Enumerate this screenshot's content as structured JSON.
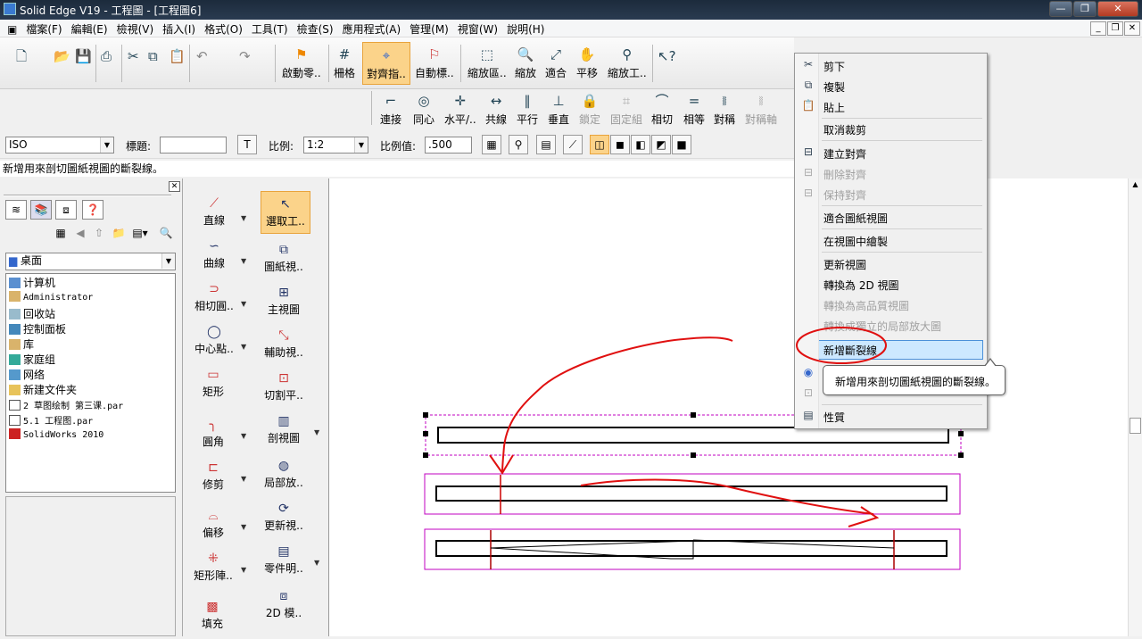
{
  "window": {
    "title": "Solid Edge V19 - 工程圖 - [工程圖6]"
  },
  "menu": [
    "檔案(F)",
    "編輯(E)",
    "檢視(V)",
    "插入(I)",
    "格式(O)",
    "工具(T)",
    "檢查(S)",
    "應用程式(A)",
    "管理(M)",
    "視窗(W)",
    "說明(H)"
  ],
  "toolbar1": {
    "start": "啟動零..",
    "grid": "柵格",
    "align": "對齊指..",
    "auto": "自動標..",
    "zoom_area": "縮放區..",
    "zoom": "縮放",
    "fit": "適合",
    "pan": "平移",
    "zoom_tool": "縮放工.."
  },
  "toolbar2": [
    "連接",
    "同心",
    "水平/..",
    "共線",
    "平行",
    "垂直",
    "鎖定",
    "固定組",
    "相切",
    "相等",
    "對稱",
    "對稱軸"
  ],
  "toolbar3": {
    "standard": "ISO",
    "title_label": "標題:",
    "title_value": "",
    "scale_label": "比例:",
    "scale_value": "1:2",
    "scale_val_label": "比例值:",
    "scale_val_value": ".500"
  },
  "status_text": "新增用來剖切圖紙視圖的斷裂線。",
  "library": {
    "location": "桌面",
    "items": [
      "计算机",
      "Administrator",
      "回收站",
      "控制面板",
      "库",
      "家庭组",
      "网络",
      "新建文件夹",
      "2 草图绘制 第三课.par",
      "5.1 工程图.par",
      "SolidWorks 2010"
    ]
  },
  "draw_tools": [
    "直線",
    "曲線",
    "相切圓..",
    "中心點..",
    "矩形",
    "圓角",
    "修剪",
    "偏移",
    "矩形陣..",
    "填充"
  ],
  "view_tools": [
    "選取工..",
    "圖紙視..",
    "主視圖",
    "輔助視..",
    "切割平..",
    "剖視圖",
    "局部放..",
    "更新視..",
    "零件明..",
    "2D 模.."
  ],
  "context_menu": {
    "items": [
      "剪下",
      "複製",
      "貼上",
      "取消裁剪",
      "建立對齊",
      "刪除對齊",
      "保持對齊",
      "適合圖紙視圖",
      "在視圖中繪製",
      "更新視圖",
      "轉換為 2D 視圖",
      "轉換為高品質視圖",
      "轉換成獨立的局部放大圖",
      "新增斷裂線",
      "性質"
    ],
    "tooltip": "新增用來剖切圖紙視圖的斷裂線。"
  },
  "colors": {
    "accent_orange": "#fbd38a",
    "annotation_red": "#e01010",
    "view_border": "#c000c0"
  }
}
